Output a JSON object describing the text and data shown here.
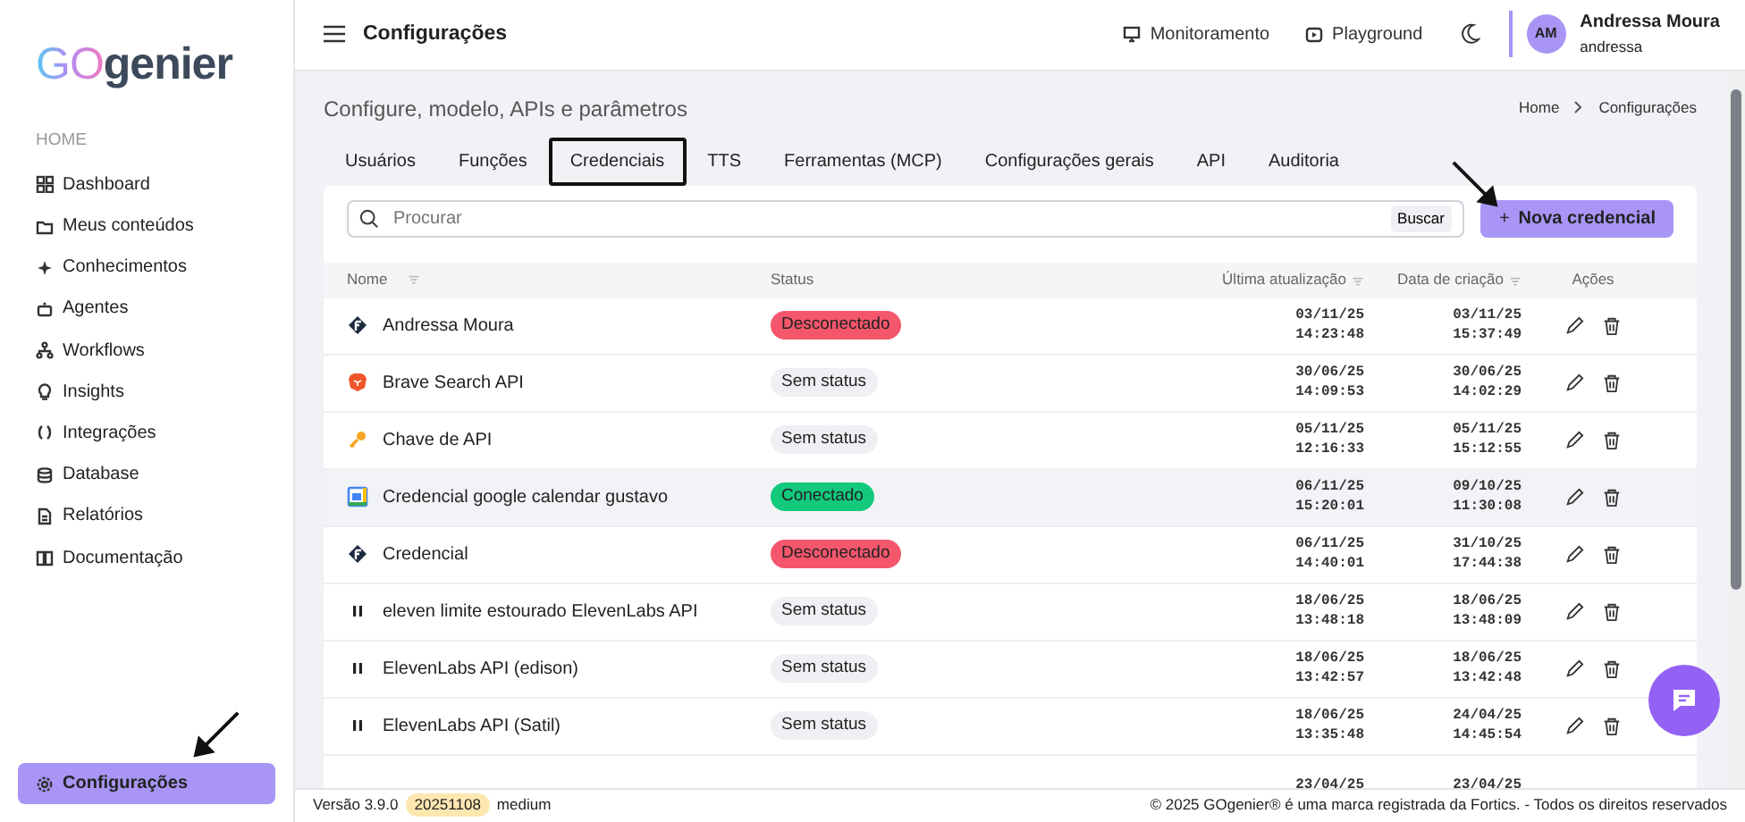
{
  "sidebar": {
    "logo": {
      "prefix": "GO",
      "name": "genier"
    },
    "section": "HOME",
    "items": [
      {
        "label": "Dashboard",
        "selected": false
      },
      {
        "label": "Meus conteúdos",
        "selected": false
      },
      {
        "label": "Conhecimentos",
        "selected": false
      },
      {
        "label": "Agentes",
        "selected": false
      },
      {
        "label": "Workflows",
        "selected": false
      },
      {
        "label": "Insights",
        "selected": false
      },
      {
        "label": "Integrações",
        "selected": false
      },
      {
        "label": "Database",
        "selected": false
      },
      {
        "label": "Relatórios",
        "selected": false
      },
      {
        "label": "Documentação",
        "selected": false
      }
    ],
    "bottom_item": {
      "label": "Configurações",
      "selected": true
    }
  },
  "header": {
    "title": "Configurações",
    "links": [
      {
        "label": "Monitoramento"
      },
      {
        "label": "Playground"
      }
    ],
    "user": {
      "initials": "AM",
      "name": "Andressa Moura",
      "login": "andressa"
    }
  },
  "page": {
    "subtitle": "Configure, modelo, APIs e parâmetros",
    "breadcrumb": [
      "Home",
      "Configurações"
    ]
  },
  "tabs": [
    {
      "label": "Usuários",
      "selected": false
    },
    {
      "label": "Funções",
      "selected": false
    },
    {
      "label": "Credenciais",
      "selected": true
    },
    {
      "label": "TTS",
      "selected": false
    },
    {
      "label": "Ferramentas (MCP)",
      "selected": false
    },
    {
      "label": "Configurações gerais",
      "selected": false
    },
    {
      "label": "API",
      "selected": false
    },
    {
      "label": "Auditoria",
      "selected": false
    }
  ],
  "search": {
    "placeholder": "Procurar",
    "button": "Buscar"
  },
  "new_button": {
    "icon": "+",
    "label": "Nova credencial"
  },
  "table": {
    "columns": [
      "Nome",
      "Status",
      "Última atualização",
      "Data de criação",
      "Ações"
    ],
    "rows": [
      {
        "kind": "fortics",
        "name": "Andressa Moura",
        "status": "Desconectado",
        "color": "#f4566c",
        "updated": [
          "03/11/25",
          "14:23:48"
        ],
        "created": [
          "03/11/25",
          "15:37:49"
        ],
        "hovered": false
      },
      {
        "kind": "brave",
        "name": "Brave Search API",
        "status": "Sem status",
        "color": "#eef0f3",
        "updated": [
          "30/06/25",
          "14:09:53"
        ],
        "created": [
          "30/06/25",
          "14:02:29"
        ],
        "hovered": false
      },
      {
        "kind": "key",
        "name": "Chave de API",
        "status": "Sem status",
        "color": "#eef0f3",
        "updated": [
          "05/11/25",
          "12:16:33"
        ],
        "created": [
          "05/11/25",
          "15:12:55"
        ],
        "hovered": false
      },
      {
        "kind": "gcal",
        "name": "Credencial google calendar gustavo",
        "status": "Conectado",
        "color": "#12c97c",
        "updated": [
          "06/11/25",
          "15:20:01"
        ],
        "created": [
          "09/10/25",
          "11:30:08"
        ],
        "hovered": true
      },
      {
        "kind": "fortics",
        "name": "Credencial",
        "status": "Desconectado",
        "color": "#f4566c",
        "updated": [
          "06/11/25",
          "14:40:01"
        ],
        "created": [
          "31/10/25",
          "17:44:38"
        ],
        "hovered": false
      },
      {
        "kind": "pause",
        "name": "eleven limite estourado ElevenLabs API",
        "status": "Sem status",
        "color": "#eef0f3",
        "updated": [
          "18/06/25",
          "13:48:18"
        ],
        "created": [
          "18/06/25",
          "13:48:09"
        ],
        "hovered": false
      },
      {
        "kind": "pause",
        "name": "ElevenLabs API (edison)",
        "status": "Sem status",
        "color": "#eef0f3",
        "updated": [
          "18/06/25",
          "13:42:57"
        ],
        "created": [
          "18/06/25",
          "13:42:48"
        ],
        "hovered": false
      },
      {
        "kind": "pause",
        "name": "ElevenLabs API (Satil)",
        "status": "Sem status",
        "color": "#eef0f3",
        "updated": [
          "18/06/25",
          "13:35:48"
        ],
        "created": [
          "24/04/25",
          "14:45:54"
        ],
        "hovered": false
      },
      {
        "updated": [
          "23/04/25"
        ],
        "created": [
          "23/04/25"
        ],
        "hovered": false
      }
    ]
  },
  "footer": {
    "version": "Versão 3.9.0",
    "build": "20251108",
    "tier": "medium",
    "copyright": "© 2025 GOgenier® é uma marca registrada da Fortics. - Todos os direitos reservados"
  }
}
